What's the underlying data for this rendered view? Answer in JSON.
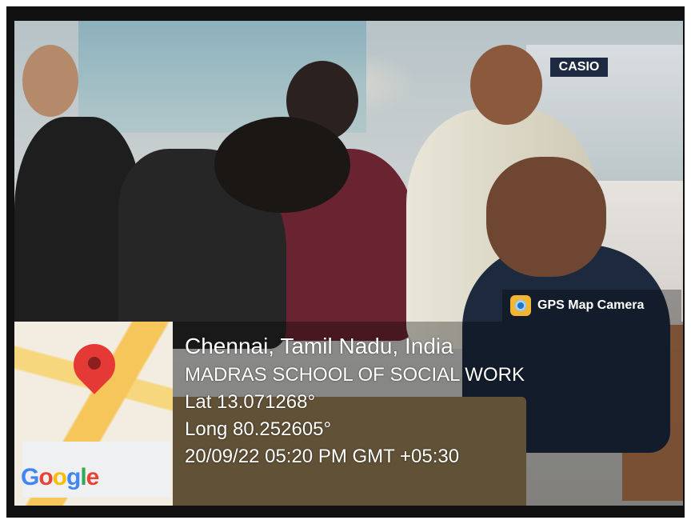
{
  "photo": {
    "store_sign": "CASIO",
    "badge": {
      "icon": "gps-camera-icon",
      "label": "GPS Map Camera"
    },
    "map": {
      "icon": "location-pin-icon",
      "brand": "Google",
      "brand_letters": [
        "G",
        "o",
        "o",
        "g",
        "l",
        "e"
      ]
    },
    "location": {
      "place": "Chennai, Tamil Nadu, India",
      "institution": "MADRAS SCHOOL OF SOCIAL WORK",
      "lat": "Lat 13.071268°",
      "long": "Long 80.252605°",
      "datetime": "20/09/22 05:20 PM GMT +05:30"
    }
  }
}
